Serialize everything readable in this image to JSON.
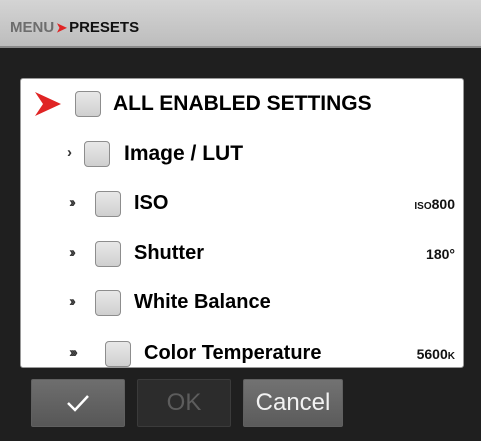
{
  "breadcrumb": {
    "menu": "MENU",
    "separator": "➤",
    "current": "PRESETS"
  },
  "settings": {
    "all": "ALL ENABLED SETTINGS",
    "image_lut": "Image / LUT",
    "iso": {
      "label": "ISO",
      "value_prefix": "ISO",
      "value_number": "800"
    },
    "shutter": {
      "label": "Shutter",
      "value": "180°"
    },
    "white_balance": "White Balance",
    "color_temperature": {
      "label": "Color Temperature",
      "value_number": "5600",
      "value_unit": "K"
    }
  },
  "chevrons": {
    "one": "›",
    "two": "››",
    "three": "›››"
  },
  "buttons": {
    "confirm_icon": "check-icon",
    "ok": "OK",
    "cancel": "Cancel"
  },
  "colors": {
    "accent_red": "#e02424",
    "header": "#c8c8c8"
  }
}
